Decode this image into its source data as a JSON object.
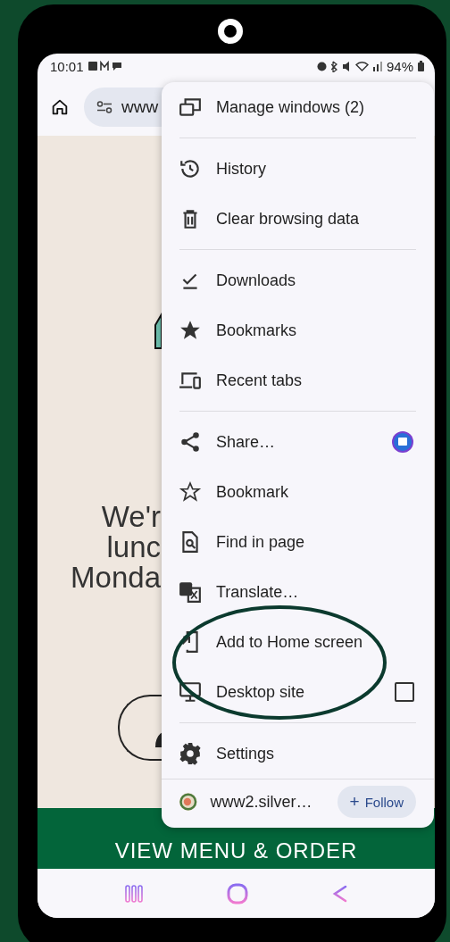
{
  "status_bar": {
    "time": "10:01",
    "battery": "94%"
  },
  "address_bar": {
    "url": "www"
  },
  "page": {
    "headline_lines": [
      "We'r",
      "lunc",
      "Monda"
    ],
    "banner": "VIEW MENU & ORDER"
  },
  "menu": {
    "sections": [
      [
        {
          "label": "Manage windows (2)",
          "kind": "plain"
        }
      ],
      [
        {
          "label": "History",
          "kind": "plain"
        },
        {
          "label": "Clear browsing data",
          "kind": "plain"
        }
      ],
      [
        {
          "label": "Downloads",
          "kind": "plain"
        },
        {
          "label": "Bookmarks",
          "kind": "plain"
        },
        {
          "label": "Recent tabs",
          "kind": "plain"
        }
      ],
      [
        {
          "label": "Share…",
          "kind": "share"
        },
        {
          "label": "Bookmark",
          "kind": "plain"
        },
        {
          "label": "Find in page",
          "kind": "plain"
        },
        {
          "label": "Translate…",
          "kind": "plain"
        },
        {
          "label": "Add to Home screen",
          "kind": "plain"
        },
        {
          "label": "Desktop site",
          "kind": "checkbox",
          "checked": false
        }
      ],
      [
        {
          "label": "Settings",
          "kind": "plain"
        }
      ]
    ],
    "site": {
      "name": "www2.silver…",
      "follow": "Follow",
      "follow_icon": "+"
    }
  }
}
